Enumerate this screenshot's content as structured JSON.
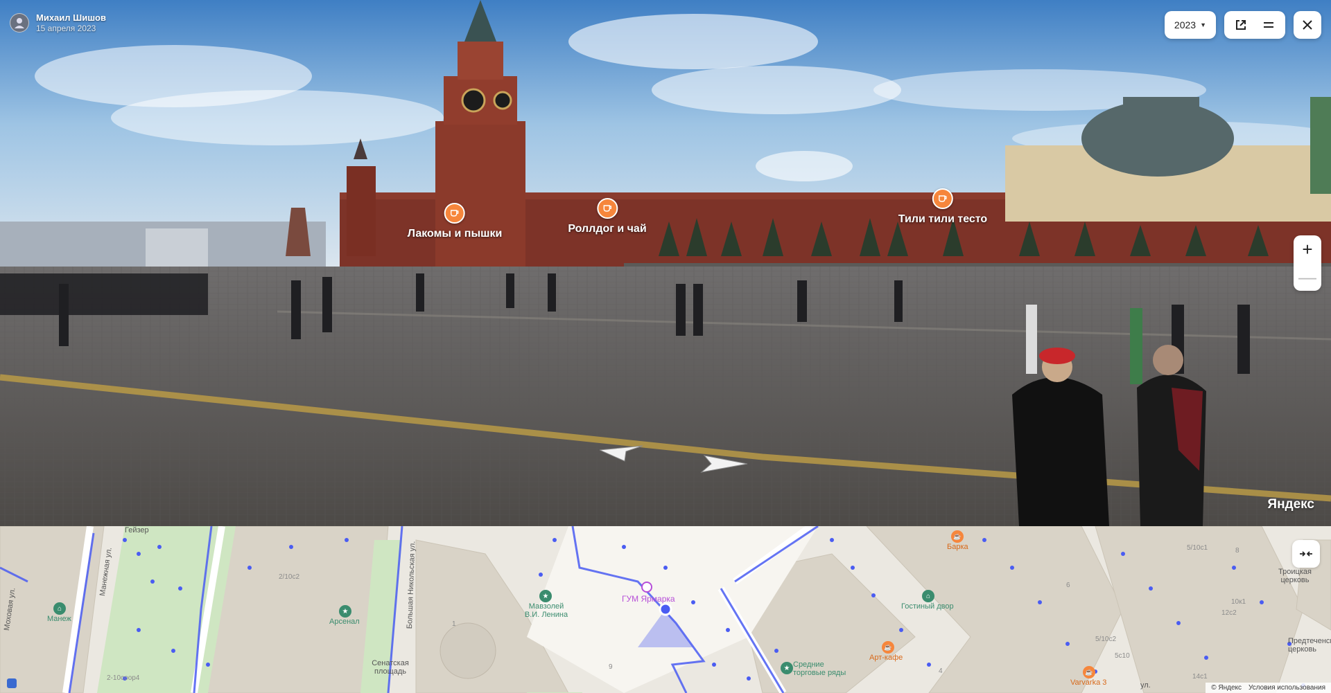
{
  "author": {
    "name": "Михаил Шишов",
    "date": "15 апреля 2023"
  },
  "controls": {
    "year": "2023"
  },
  "pano_pois": [
    {
      "label": "Лакомы и пышки"
    },
    {
      "label": "Роллдог и чай"
    },
    {
      "label": "Тили тили тесто"
    }
  ],
  "brand": "Яндекс",
  "map": {
    "streets": {
      "mokhovaya": "Моховая ул.",
      "manezhnaya": "Манежная ул.",
      "nikolskaya": "Большая Никольская ул.",
      "il": "ул.",
      "senate": "Сенатская площадь"
    },
    "places": {
      "geyser": "Гейзер",
      "manezh": "Манеж",
      "arsenal": "Арсенал",
      "mausoleum": "Мавзолей В.И. Ленина",
      "gum": "ГУМ Ярмарка",
      "barka": "Барка",
      "gostiny": "Гостиный двор",
      "sredniye": "Средние торговые ряды",
      "artcafe": "Арт-кафе",
      "varvarka": "Varvarka 3",
      "troitskaya": "Троицкая церковь",
      "predtech": "Предтеченска церковь"
    },
    "numbers": [
      "2/10с2",
      "2-10соор4",
      "1",
      "9",
      "4",
      "6",
      "5/10с1",
      "5/10с2",
      "5с10",
      "12с2",
      "14с1",
      "10к1",
      "8"
    ],
    "copyright": "© Яндекс",
    "terms": "Условия использования"
  },
  "colors": {
    "poi": "#f6863c",
    "route": "#4a5cf2",
    "purple": "#b64ed8"
  }
}
